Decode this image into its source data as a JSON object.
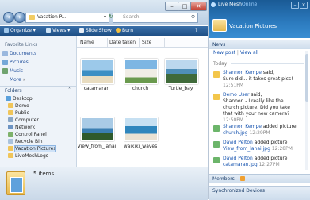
{
  "explorer": {
    "address": "Vacation P...",
    "search_placeholder": "Search",
    "toolbar": {
      "organize": "Organize",
      "views": "Views",
      "slideshow": "Slide Show",
      "burn": "Burn"
    },
    "favorite_links_header": "Favorite Links",
    "favorites": [
      "Documents",
      "Pictures",
      "Music"
    ],
    "more_label": "More",
    "folders_header": "Folders",
    "tree": [
      "Desktop",
      "Demo",
      "Public",
      "Computer",
      "Network",
      "Control Panel",
      "Recycle Bin",
      "Vacation Pictures",
      "LiveMeshLogs"
    ],
    "columns": [
      "Name",
      "Date taken",
      "Size"
    ],
    "files": [
      {
        "name": "catamaran"
      },
      {
        "name": "church"
      },
      {
        "name": "Turtle_bay"
      },
      {
        "name": "View_from_lanai"
      },
      {
        "name": "waikiki_waves"
      }
    ],
    "status": "5 items"
  },
  "mesh": {
    "app_name": "Live Mesh",
    "status_suffix": "Online",
    "folder_title": "Vacation Pictures",
    "news_header": "News",
    "new_post": "New post",
    "view_all": "View all",
    "today_label": "Today",
    "feed": [
      {
        "author": "Shannon Kempe",
        "line1": " said,",
        "line2": "Sure did... it takes great pics!",
        "time": "12:51PM"
      },
      {
        "author": "Demo User",
        "line1": " said,",
        "line2": "Shannon - I really like the church picture. Did you take that with your new camera?",
        "time": "12:50PM"
      },
      {
        "author": "Shannon Kempe",
        "line1": " added picture",
        "link": "church.jpg",
        "time": "12:29PM"
      },
      {
        "author": "David Pelton",
        "line1": " added picture",
        "link": "View_from_lanai.jpg",
        "time": "12:28PM"
      },
      {
        "author": "David Pelton",
        "line1": " added picture",
        "link": "catamaran.jpg",
        "time": "12:27PM"
      }
    ],
    "members_header": "Members",
    "sync_header": "Synchronized Devices"
  }
}
